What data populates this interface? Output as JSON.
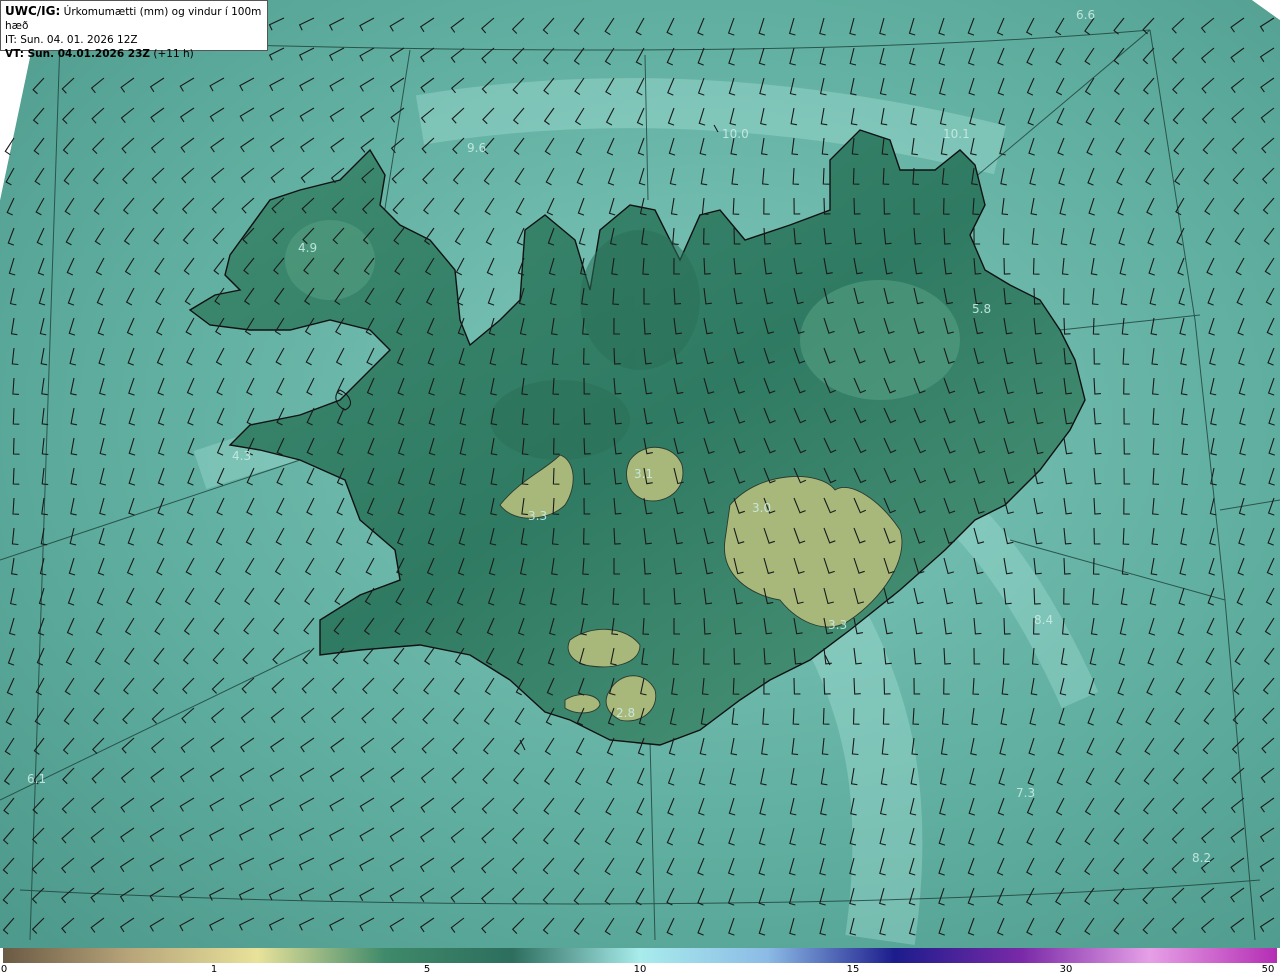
{
  "header": {
    "model": "UWC/IG:",
    "title": "Úrkomumætti (mm) og vindur í 100m hæð",
    "init_time": "IT: Sun. 04. 01. 2026 12Z",
    "valid_label": "VT: Sun. 04.01.2026 23Z",
    "valid_offset": "(+11 h)"
  },
  "colors": {
    "sea": "#5fb0a3",
    "sea_light": "#9cdcd5",
    "land_dark": "#2d7a62",
    "land_mid": "#4a9476",
    "glacier": "#a7b97a",
    "coast": "#111111",
    "barb": "#1a1a1a"
  },
  "colorbar": {
    "ticks": [
      "0",
      "1",
      "5",
      "10",
      "15",
      "30",
      "50"
    ],
    "stops": [
      "#6b5a44",
      "#b8a57a",
      "#e8e29a",
      "#3f8a6a",
      "#2d6e5e",
      "#a8ecec",
      "#8cbbe6",
      "#1c1c8c",
      "#7a2aa8",
      "#e6a0e6",
      "#b42db4"
    ]
  },
  "map_labels": [
    {
      "text": "6.6"
    },
    {
      "text": "9.6"
    },
    {
      "text": "10.0"
    },
    {
      "text": "10.1"
    },
    {
      "text": "4.9"
    },
    {
      "text": "5.8"
    },
    {
      "text": "4.3"
    },
    {
      "text": "3.1"
    },
    {
      "text": "3.3"
    },
    {
      "text": "3.0"
    },
    {
      "text": "3.3"
    },
    {
      "text": "8.4"
    },
    {
      "text": "2.8"
    },
    {
      "text": "6.1"
    },
    {
      "text": "7.3"
    },
    {
      "text": "8.2"
    }
  ],
  "icons": {
    "wind_barbs": "wind-barb-icon"
  }
}
